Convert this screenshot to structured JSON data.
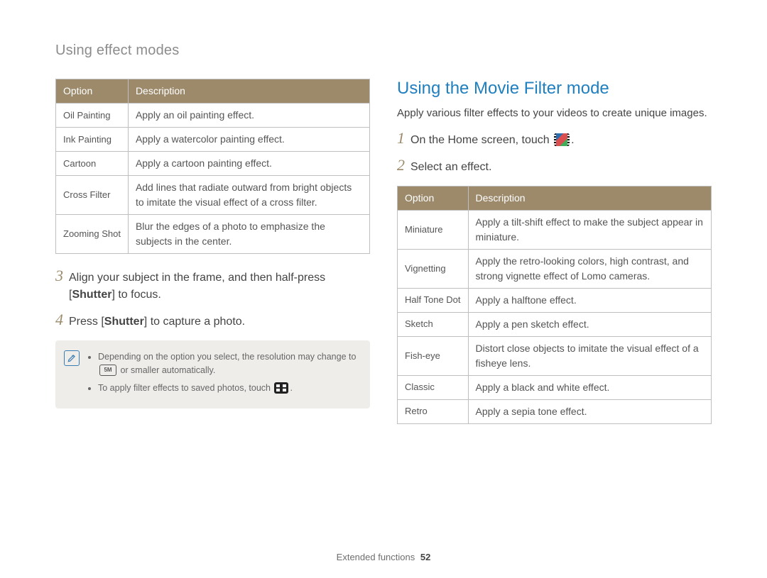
{
  "breadcrumb": "Using effect modes",
  "left_table": {
    "header_option": "Option",
    "header_desc": "Description",
    "rows": [
      {
        "option": "Oil Painting",
        "desc": "Apply an oil painting effect."
      },
      {
        "option": "Ink Painting",
        "desc": "Apply a watercolor painting effect."
      },
      {
        "option": "Cartoon",
        "desc": "Apply a cartoon painting effect."
      },
      {
        "option": "Cross Filter",
        "desc": "Add lines that radiate outward from bright objects to imitate the visual effect of a cross filter."
      },
      {
        "option": "Zooming Shot",
        "desc": "Blur the edges of a photo to emphasize the subjects in the center."
      }
    ]
  },
  "left_steps": {
    "s3_num": "3",
    "s3_a": "Align your subject in the frame, and then half-press [",
    "s3_bold": "Shutter",
    "s3_c": "] to focus.",
    "s4_num": "4",
    "s4_a": "Press [",
    "s4_bold": "Shutter",
    "s4_c": "] to capture a photo."
  },
  "note": {
    "b1_a": "Depending on the option you select, the resolution may change to ",
    "b1_res_label": "5M",
    "b1_b": " or smaller automatically.",
    "b2_a": "To apply filter effects to saved photos, touch ",
    "b2_b": "."
  },
  "right": {
    "title": "Using the Movie Filter mode",
    "lead": "Apply various filter effects to your videos to create unique images.",
    "s1_num": "1",
    "s1_a": "On the Home screen, touch ",
    "s1_b": ".",
    "s2_num": "2",
    "s2": "Select an effect."
  },
  "right_table": {
    "header_option": "Option",
    "header_desc": "Description",
    "rows": [
      {
        "option": "Miniature",
        "desc": "Apply a tilt-shift effect to make the subject appear in miniature."
      },
      {
        "option": "Vignetting",
        "desc": "Apply the retro-looking colors, high contrast, and strong vignette effect of Lomo cameras."
      },
      {
        "option": "Half Tone Dot",
        "desc": "Apply a halftone effect."
      },
      {
        "option": "Sketch",
        "desc": "Apply a pen sketch effect."
      },
      {
        "option": "Fish-eye",
        "desc": "Distort close objects to imitate the visual effect of a fisheye lens."
      },
      {
        "option": "Classic",
        "desc": "Apply a black and white effect."
      },
      {
        "option": "Retro",
        "desc": "Apply a sepia tone effect."
      }
    ]
  },
  "footer": {
    "section": "Extended functions",
    "page": "52"
  }
}
